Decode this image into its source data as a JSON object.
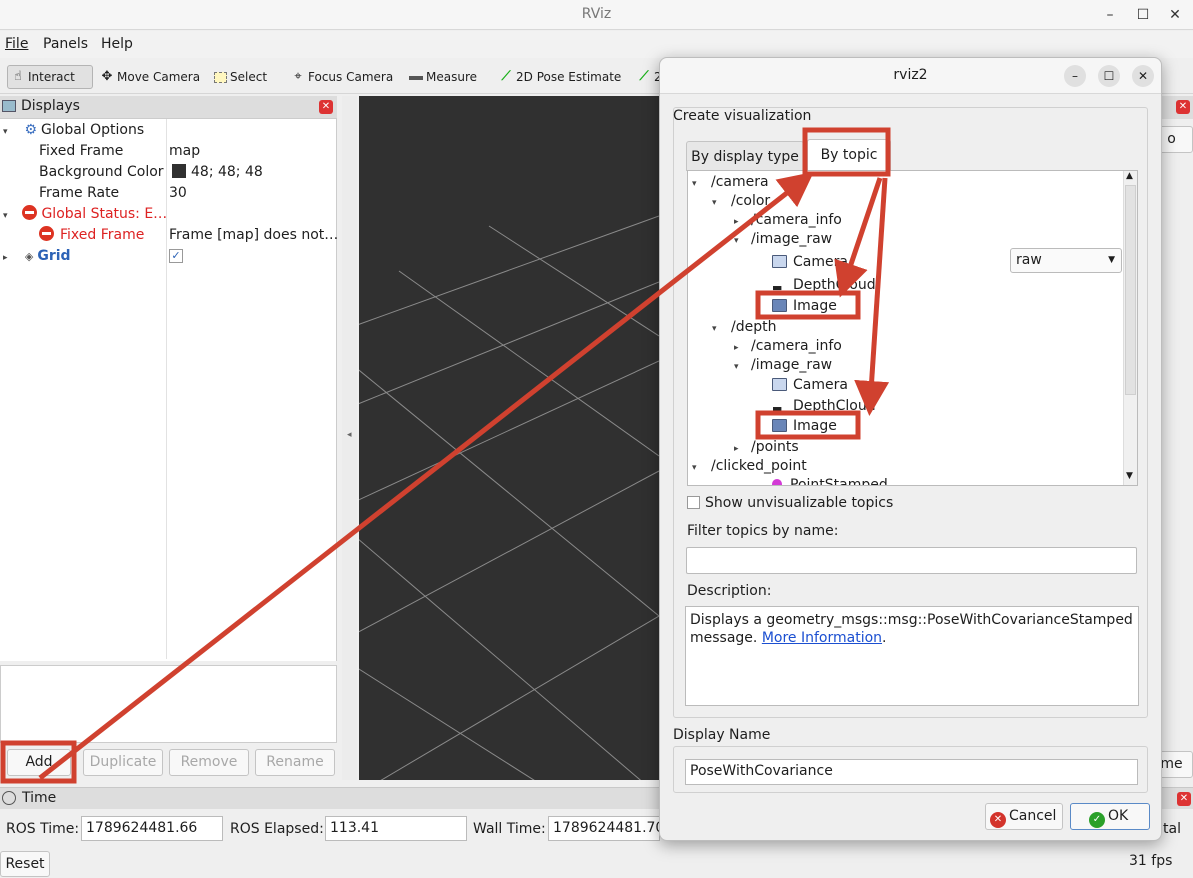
{
  "window": {
    "title": "RViz"
  },
  "menu": [
    "File",
    "Panels",
    "Help"
  ],
  "toolbar": [
    {
      "label": "Interact",
      "icon": "hand-icon"
    },
    {
      "label": "Move Camera",
      "icon": "move-camera-icon"
    },
    {
      "label": "Select",
      "icon": "select-icon"
    },
    {
      "label": "Focus Camera",
      "icon": "focus-camera-icon"
    },
    {
      "label": "Measure",
      "icon": "measure-icon"
    },
    {
      "label": "2D Pose Estimate",
      "icon": "pose-estimate-icon"
    },
    {
      "label": "2",
      "icon": "goal-pose-icon"
    }
  ],
  "displays": {
    "title": "Displays",
    "global_options": "Global Options",
    "fixed_frame_label": "Fixed Frame",
    "fixed_frame_value": "map",
    "bg_label": "Background Color",
    "bg_value": "48; 48; 48",
    "frame_rate_label": "Frame Rate",
    "frame_rate_value": "30",
    "global_status": "Global Status: E…",
    "status_fixed_frame": "Fixed Frame",
    "status_fixed_frame_value": "Frame [map] does not…",
    "grid": "Grid",
    "grid_check": "✓",
    "buttons": {
      "add": "Add",
      "duplicate": "Duplicate",
      "remove": "Remove",
      "rename": "Rename"
    }
  },
  "time": {
    "title": "Time",
    "ros_time_label": "ROS Time:",
    "ros_time_value": "1789624481.66",
    "ros_elapsed_label": "ROS Elapsed:",
    "ros_elapsed_value": "113.41",
    "wall_time_label": "Wall Time:",
    "wall_time_value": "1789624481.70",
    "reset": "Reset",
    "fps": "31 fps",
    "right_fragment_btn": "me",
    "right_fragment_text": "tal",
    "right_fragment_top": "o"
  },
  "dialog": {
    "title": "rviz2",
    "create_label": "Create visualization",
    "tab_display_type": "By display type",
    "tab_topic": "By topic",
    "tree": {
      "camera": "/camera",
      "color": "/color",
      "color_camera_info": "/camera_info",
      "color_image_raw": "/image_raw",
      "color_camera": "Camera",
      "color_depthcloud": "DepthCloud",
      "color_image": "Image",
      "depth": "/depth",
      "depth_camera_info": "/camera_info",
      "depth_image_raw": "/image_raw",
      "depth_camera": "Camera",
      "depth_depthcloud": "DepthCloud",
      "depth_image": "Image",
      "points": "/points",
      "clicked_point": "/clicked_point",
      "point_stamped": "PointStamped"
    },
    "transport_select": "raw",
    "show_unvisualizable": "Show unvisualizable topics",
    "filter_label": "Filter topics by name:",
    "filter_value": "",
    "description_label": "Description:",
    "description_text": "Displays a geometry_msgs::msg::PoseWithCovarianceStamped message.",
    "description_link": "More Information",
    "description_end": ".",
    "display_name_label": "Display Name",
    "display_name_value": "PoseWithCovariance",
    "cancel": "Cancel",
    "ok": "OK"
  },
  "annotation_color": "#d0412f"
}
